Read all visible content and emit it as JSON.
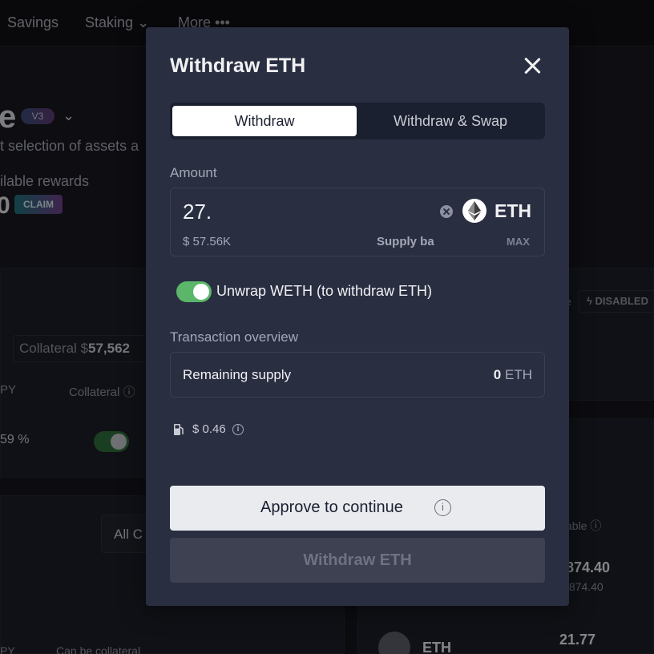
{
  "nav": {
    "savings": "Savings",
    "staking": "Staking",
    "more": "More •••"
  },
  "hero": {
    "title_fragment": "e",
    "version_badge": "V3",
    "subtitle_fragment": "t selection of assets a",
    "rewards_label": "ilable rewards",
    "rewards_value": "0",
    "claim_label": "CLAIM"
  },
  "bg_supplies": {
    "collateral_label": "Collateral $",
    "collateral_value": "57,562",
    "apy_header": "PY",
    "collateral_header": "Collateral",
    "apy_value": "59 %",
    "all_categories": "All C",
    "col_a": "PY",
    "col_b": "Can be collateral"
  },
  "bg_borrows": {
    "e_fragment": "e",
    "disabled_badge": "DISABLED",
    "available_header": "able",
    "value_1": "874.40",
    "value_2": ",874.40",
    "eth_label": "ETH",
    "eth_value": "21.77"
  },
  "modal": {
    "title": "Withdraw ETH",
    "tabs": [
      "Withdraw",
      "Withdraw & Swap"
    ],
    "amount_label": "Amount",
    "amount_value": "27.",
    "token_symbol": "ETH",
    "usd_value": "$ 57.56K",
    "supply_balance_label": "Supply ba",
    "max_label": "MAX",
    "unwrap_label": "Unwrap WETH (to withdraw ETH)",
    "unwrap_enabled": true,
    "overview_title": "Transaction overview",
    "remaining_label": "Remaining supply",
    "remaining_value": "0",
    "remaining_unit": "ETH",
    "gas_value": "$ 0.46",
    "approve_label": "Approve to continue",
    "withdraw_label": "Withdraw ETH"
  },
  "icons": {
    "close": "close-icon",
    "clear": "clear-icon",
    "token": "eth-icon",
    "gas": "gas-pump-icon",
    "info": "info-icon"
  },
  "colors": {
    "modal_bg": "#292e41",
    "toggle_on": "#5bb66a",
    "primary_btn": "#eaebef",
    "disabled_btn": "#3d4152"
  }
}
